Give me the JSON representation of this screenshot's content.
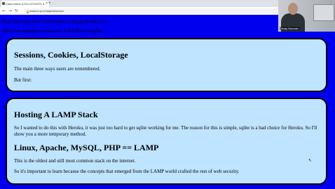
{
  "browser": {
    "tab_title": "Class Notes (CSCI-3720/370 5...",
    "url": "osssum.prof.ninja/sessions/"
  },
  "webcam": {
    "name": "Andy Novocin"
  },
  "page": {
    "style_line": "Don't like this style? Click here to change it! blue.css",
    "welcome_line": "Welcome andy@novocin.com, Click here to logout",
    "card1": {
      "title": "Sessions, Cookies, LocalStorage",
      "p1": "The main three ways users are remembered.",
      "p2": "But first:"
    },
    "card2": {
      "title": "Hosting A LAMP Stack",
      "p1": "So I wanted to do this with Heroku, it was just too hard to get sqlite working for me. The reason for this is simple, sqlite is a bad choice for Heroku. So I'll show you a more temporary method.",
      "subtitle": "Linux, Apache, MySQL, PHP == LAMP",
      "p2": "This is the oldest and still most common stack on the internet.",
      "p3": "So it's important to learn because the concepts that emerged from the LAMP world crafted the rest of web security."
    }
  }
}
